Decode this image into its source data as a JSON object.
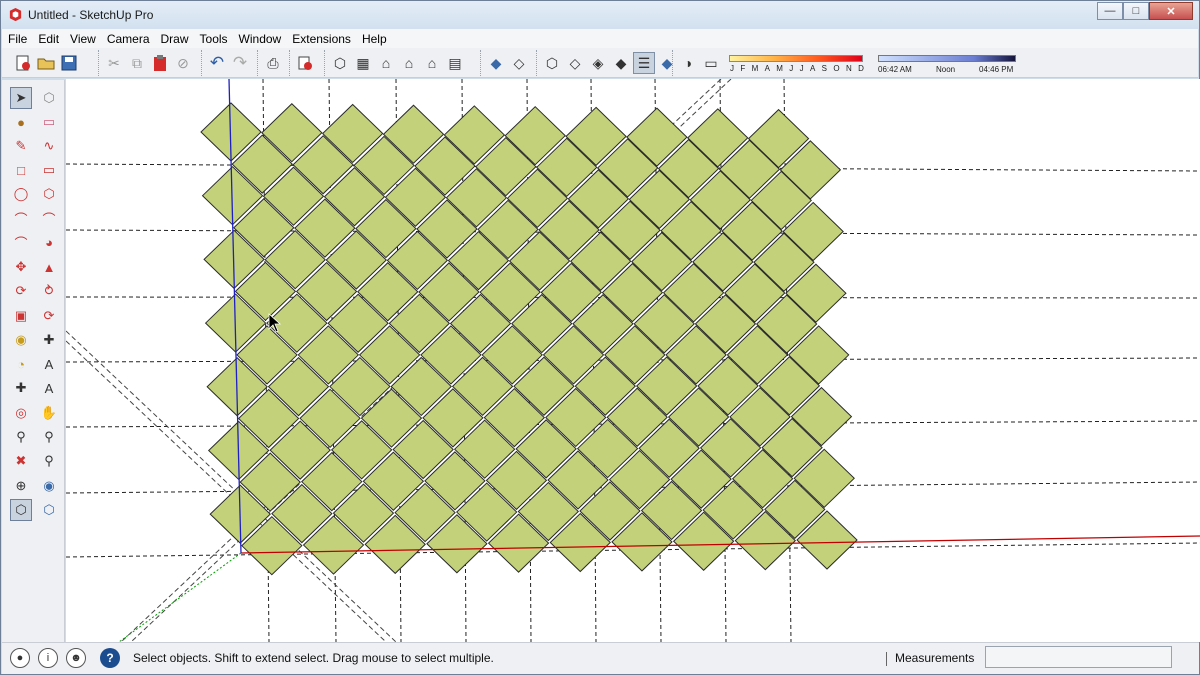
{
  "window": {
    "title": "Untitled - SketchUp Pro"
  },
  "menu": [
    "File",
    "Edit",
    "View",
    "Camera",
    "Draw",
    "Tools",
    "Window",
    "Extensions",
    "Help"
  ],
  "shadows": {
    "months": [
      "J",
      "F",
      "M",
      "A",
      "M",
      "J",
      "J",
      "A",
      "S",
      "O",
      "N",
      "D"
    ],
    "time_start": "06:42 AM",
    "time_mid": "Noon",
    "time_end": "04:46 PM"
  },
  "status": {
    "message": "Select objects. Shift to extend select. Drag mouse to select multiple.",
    "measurements_label": "Measurements",
    "measurements_value": ""
  },
  "colors": {
    "tile_fill": "#c3d17a",
    "tile_stroke": "#2a2a2a",
    "red_axis": "#c00000",
    "blue_axis": "#2020c0",
    "green_axis": "#00a000"
  }
}
